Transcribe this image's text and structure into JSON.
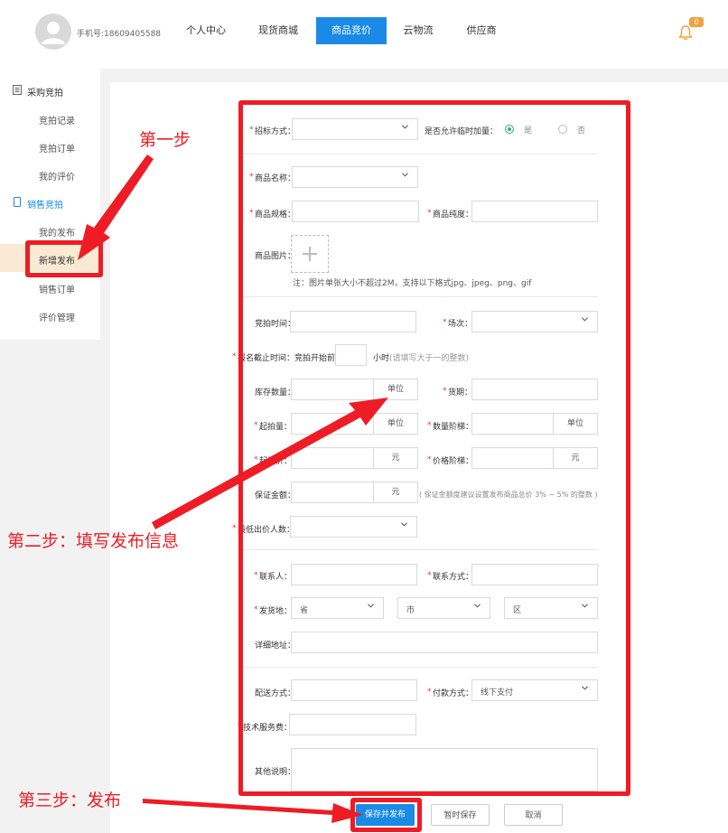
{
  "header": {
    "phone": "手机号:18609405588",
    "nav": [
      "个人中心",
      "现货商城",
      "商品竞价",
      "云物流",
      "供应商"
    ],
    "active_nav": 2,
    "notification_count": "0"
  },
  "sidebar": {
    "purchase_title": "采购竞拍",
    "purchase_items": [
      "竞拍记录",
      "竞拍订单",
      "我的评价"
    ],
    "sales_title": "销售竞拍",
    "sales_items": [
      "我的发布",
      "新增发布",
      "销售订单",
      "评价管理"
    ],
    "active_item": "新增发布"
  },
  "form": {
    "bid_method_label": "招标方式：",
    "allow_add_label": "是否允许临时加量：",
    "yes": "是",
    "no": "否",
    "product_name_label": "商品名称：",
    "product_spec_label": "商品规格：",
    "product_purity_label": "商品纯度：",
    "product_image_label": "商品图片：",
    "image_note": "注：图片单张大小不超过2M，支持以下格式jpg、jpeg、png、gif",
    "auction_time_label": "竞拍时间：",
    "session_label": "场次：",
    "signup_deadline_label": "报名截止时间：竞拍开始前",
    "hours_hint": "小时(请填写大于一的整数)",
    "hours_hint_prefix": "小时",
    "hours_hint_rest": "(请填写大于一的整数)",
    "stock_label": "库存数量：",
    "unit": "单位",
    "delivery_period_label": "货期：",
    "min_qty_label": "起拍量：",
    "qty_step_label": "数量阶梯：",
    "start_price_label": "起拍价：",
    "yuan": "元",
    "price_step_label": "价格阶梯：",
    "deposit_label": "保证金额：",
    "deposit_hint": "( 保证金额度建议设置发布商品总价 3% ~ 5% 的整数 )",
    "min_bidders_label": "最低出价人数：",
    "contact_label": "联系人：",
    "contact_method_label": "联系方式：",
    "ship_from_label": "发货地：",
    "province": "省",
    "city": "市",
    "district": "区",
    "address_label": "详细地址：",
    "delivery_method_label": "配送方式：",
    "payment_label": "付款方式：",
    "payment_value": "线下支付",
    "service_fee_label": "技术服务费：",
    "other_label": "其他说明："
  },
  "buttons": {
    "save_publish": "保存并发布",
    "save_draft": "暂时保存",
    "cancel": "取消"
  },
  "annotations": {
    "step1": "第一步",
    "step2": "第二步：填写发布信息",
    "step3": "第三步：发布"
  },
  "colors": {
    "accent": "#1a8ae6",
    "annotation_red": "#ee1c25",
    "required_star": "#e33333",
    "radio_green": "#2db35e",
    "badge_orange": "#f0a23c"
  }
}
